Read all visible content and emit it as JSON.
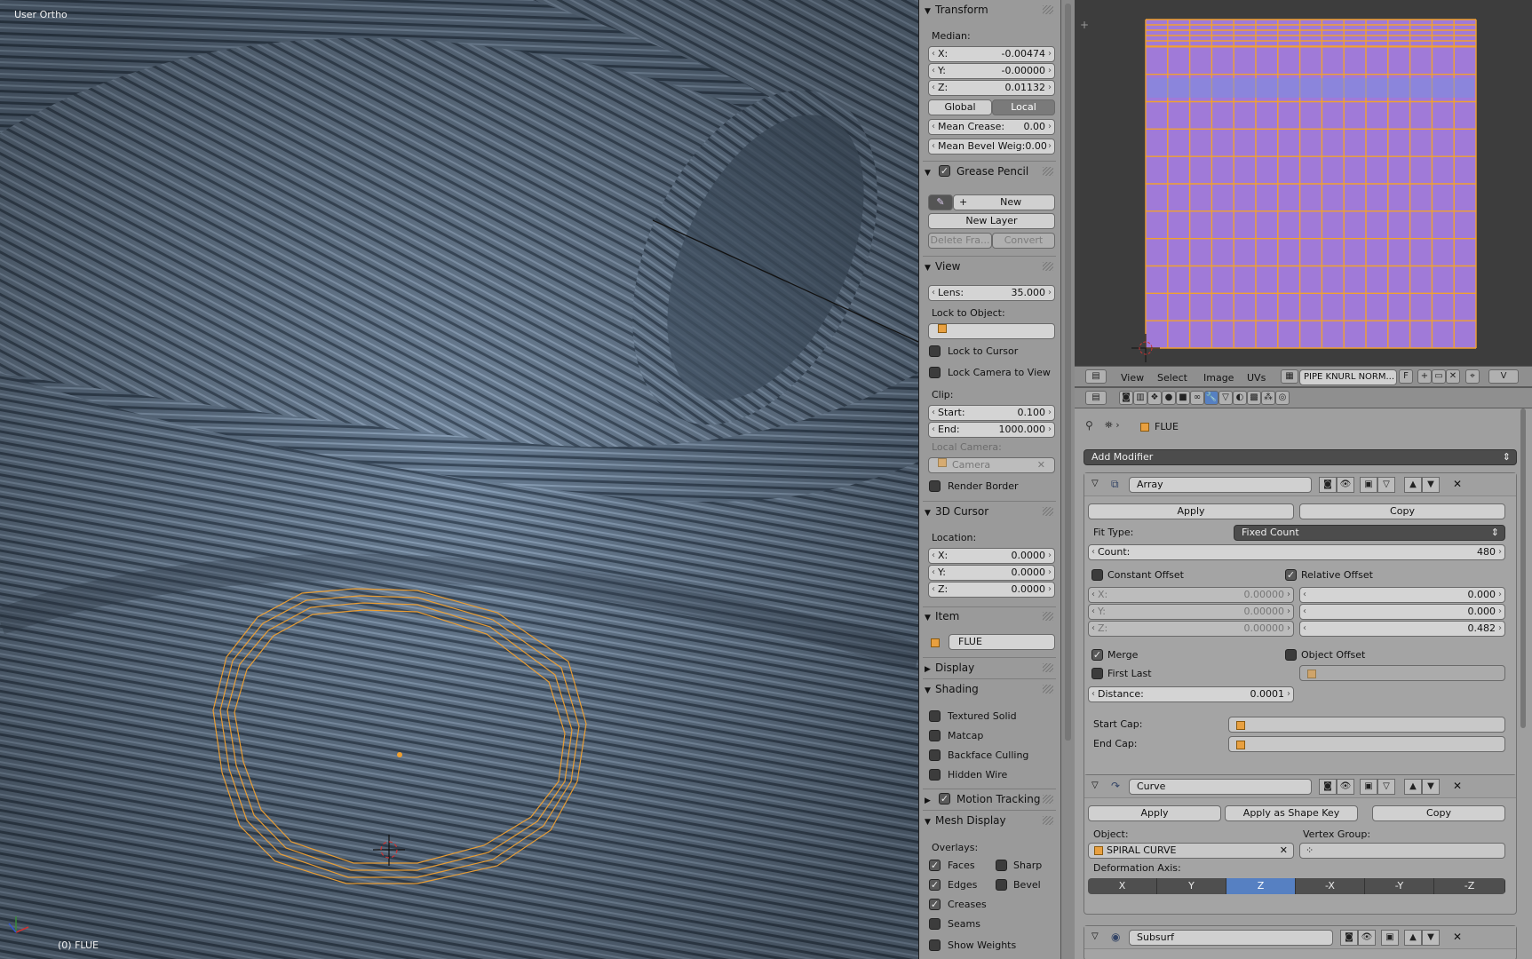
{
  "viewport": {
    "view_name": "User Ortho",
    "object_status": "(0) FLUE"
  },
  "npanel": {
    "transform": {
      "title": "Transform",
      "median_label": "Median:",
      "x_label": "X:",
      "x": "-0.00474",
      "y_label": "Y:",
      "y": "-0.00000",
      "z_label": "Z:",
      "z": "0.01132",
      "global": "Global",
      "local": "Local",
      "mean_crease_label": "Mean Crease:",
      "mean_crease": "0.00",
      "mean_bevel_label": "Mean Bevel Weig:",
      "mean_bevel": "0.00"
    },
    "grease_pencil": {
      "title": "Grease Pencil",
      "new": "New",
      "new_layer": "New Layer",
      "delete_frame": "Delete Fra...",
      "convert": "Convert"
    },
    "view": {
      "title": "View",
      "lens_label": "Lens:",
      "lens": "35.000",
      "lock_object_label": "Lock to Object:",
      "lock_cursor": "Lock to Cursor",
      "lock_camera": "Lock Camera to View",
      "clip_label": "Clip:",
      "start_label": "Start:",
      "start": "0.100",
      "end_label": "End:",
      "end": "1000.000",
      "local_camera_label": "Local Camera:",
      "camera": "Camera",
      "render_border": "Render Border"
    },
    "cursor": {
      "title": "3D Cursor",
      "location_label": "Location:",
      "x_label": "X:",
      "x": "0.0000",
      "y_label": "Y:",
      "y": "0.0000",
      "z_label": "Z:",
      "z": "0.0000"
    },
    "item": {
      "title": "Item",
      "name": "FLUE"
    },
    "display": {
      "title": "Display"
    },
    "shading": {
      "title": "Shading",
      "textured_solid": "Textured Solid",
      "matcap": "Matcap",
      "backface_culling": "Backface Culling",
      "hidden_wire": "Hidden Wire"
    },
    "motion_tracking": {
      "title": "Motion Tracking"
    },
    "mesh_display": {
      "title": "Mesh Display",
      "overlays_label": "Overlays:",
      "faces": "Faces",
      "sharp": "Sharp",
      "edges": "Edges",
      "bevel": "Bevel",
      "creases": "Creases",
      "seams": "Seams",
      "show_weights": "Show Weights"
    }
  },
  "uv_header": {
    "view": "View",
    "select": "Select",
    "image": "Image",
    "uvs": "UVs",
    "image_name": "PIPE KNURL NORM...",
    "f": "F",
    "v": "V"
  },
  "props": {
    "breadcrumb_object": "FLUE",
    "add_modifier": "Add Modifier",
    "array": {
      "name": "Array",
      "apply": "Apply",
      "copy": "Copy",
      "fit_type_label": "Fit Type:",
      "fit_type": "Fixed Count",
      "count_label": "Count:",
      "count": "480",
      "constant_offset": "Constant Offset",
      "relative_offset": "Relative Offset",
      "cx_label": "X:",
      "cx": "0.00000",
      "cy_label": "Y:",
      "cy": "0.00000",
      "cz_label": "Z:",
      "cz": "0.00000",
      "rx": "0.000",
      "ry": "0.000",
      "rz": "0.482",
      "merge": "Merge",
      "object_offset": "Object Offset",
      "first_last": "First Last",
      "distance_label": "Distance:",
      "distance": "0.0001",
      "start_cap_label": "Start Cap:",
      "end_cap_label": "End Cap:"
    },
    "curve": {
      "name": "Curve",
      "apply": "Apply",
      "apply_shape": "Apply as Shape Key",
      "copy": "Copy",
      "object_label": "Object:",
      "object": "SPIRAL CURVE",
      "vertex_group_label": "Vertex Group:",
      "deformation_axis_label": "Deformation Axis:",
      "axes": [
        "X",
        "Y",
        "Z",
        "-X",
        "-Y",
        "-Z"
      ],
      "selected_axis": "Z"
    },
    "subsurf": {
      "name": "Subsurf"
    }
  },
  "colors": {
    "selection": "#f0a030",
    "uv_face": "#a07ad8",
    "axis_selected": "#5680c2"
  }
}
